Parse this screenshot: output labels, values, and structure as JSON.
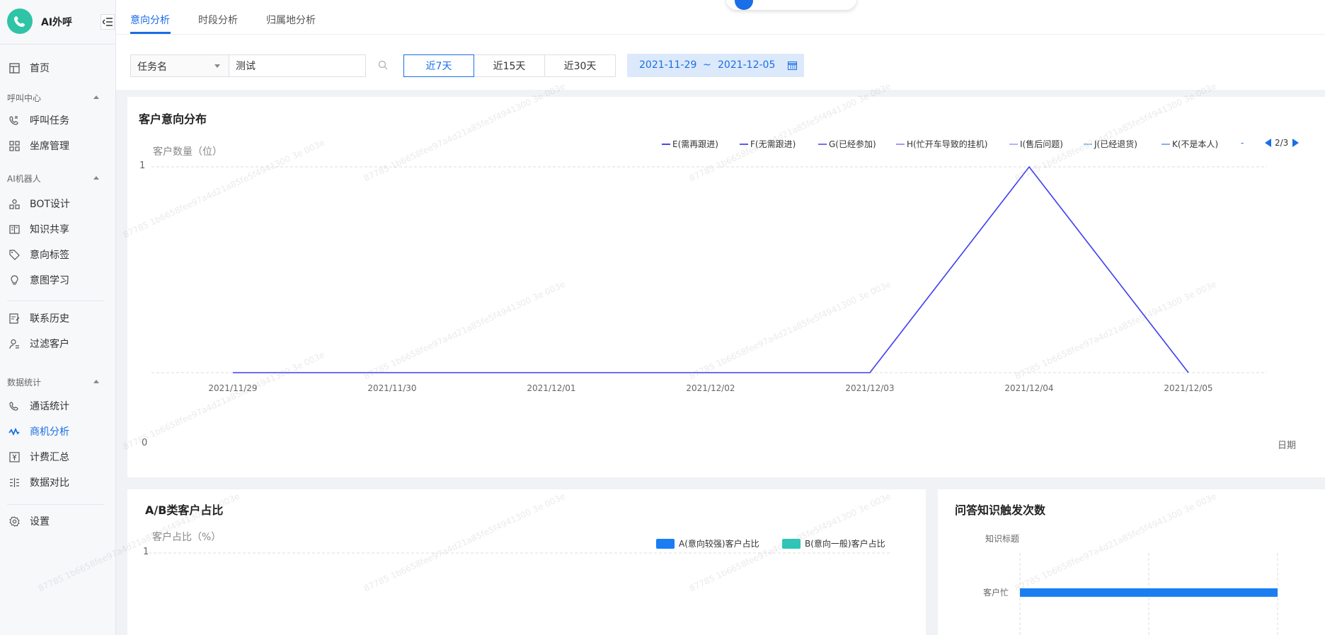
{
  "app": {
    "name": "AI外呼",
    "accent": "#1a6ee6",
    "logo_color": "#2ec4a5"
  },
  "sidebar": {
    "items": [
      {
        "label": "首页",
        "icon": "home-icon"
      },
      {
        "group": "呼叫中心"
      },
      {
        "label": "呼叫任务",
        "icon": "phone-task-icon"
      },
      {
        "label": "坐席管理",
        "icon": "grid-icon"
      },
      {
        "group": "AI机器人"
      },
      {
        "label": "BOT设计",
        "icon": "bot-design-icon"
      },
      {
        "label": "知识共享",
        "icon": "book-icon"
      },
      {
        "label": "意向标签",
        "icon": "tag-icon"
      },
      {
        "label": "意图学习",
        "icon": "bulb-icon"
      },
      {
        "label": "联系历史",
        "icon": "history-icon"
      },
      {
        "label": "过滤客户",
        "icon": "user-filter-icon"
      },
      {
        "group": "数据统计"
      },
      {
        "label": "通话统计",
        "icon": "call-stats-icon"
      },
      {
        "label": "商机分析",
        "icon": "trend-icon",
        "active": true
      },
      {
        "label": "计费汇总",
        "icon": "billing-icon"
      },
      {
        "label": "数据对比",
        "icon": "compare-icon"
      },
      {
        "label": "设置",
        "icon": "gear-icon"
      }
    ]
  },
  "tabs": [
    {
      "label": "意向分析",
      "active": true
    },
    {
      "label": "时段分析"
    },
    {
      "label": "归属地分析"
    }
  ],
  "filters": {
    "field_select": "任务名",
    "search_value": "测试",
    "ranges": [
      {
        "label": "近7天",
        "active": true
      },
      {
        "label": "近15天"
      },
      {
        "label": "近30天"
      }
    ],
    "date_start": "2021-11-29",
    "date_sep": "~",
    "date_end": "2021-12-05"
  },
  "intent_card": {
    "title": "客户意向分布",
    "legend_page": "2/3",
    "legend_overflow": "-"
  },
  "ab_card": {
    "title": "A/B类客户占比"
  },
  "qa_card": {
    "title": "问答知识触发次数"
  },
  "chart_data": [
    {
      "type": "line",
      "title": "客户意向分布",
      "ylabel": "客户数量（位）",
      "xlabel": "日期",
      "x": [
        "2021/11/29",
        "2021/11/30",
        "2021/12/01",
        "2021/12/02",
        "2021/12/03",
        "2021/12/04",
        "2021/12/05"
      ],
      "ylim": [
        0,
        1
      ],
      "yticks": [
        "0",
        "1"
      ],
      "grid": true,
      "legend_placement": "top-right",
      "legend": [
        {
          "name": "E(需再跟进)",
          "color": "#4a4ae8"
        },
        {
          "name": "F(无需跟进)",
          "color": "#5a5aee"
        },
        {
          "name": "G(已经参加)",
          "color": "#7070f0"
        },
        {
          "name": "H(忙开车导致的挂机)",
          "color": "#9c9cf4"
        },
        {
          "name": "I(售后问题)",
          "color": "#b0b4f6"
        },
        {
          "name": "J(已经退货)",
          "color": "#9cc4f4"
        },
        {
          "name": "K(不是本人)",
          "color": "#7fb0ee"
        }
      ],
      "series": [
        {
          "color": "#3d3df0",
          "values": [
            0,
            0,
            0,
            0,
            0,
            1,
            0
          ]
        }
      ]
    },
    {
      "type": "bar",
      "title": "A/B类客户占比",
      "ylabel": "客户占比（%）",
      "yticks": [
        "1"
      ],
      "grid": true,
      "legend_placement": "top-right",
      "series": [
        {
          "name": "A(意向较强)客户占比",
          "color": "#1a7ef2"
        },
        {
          "name": "B(意向一般)客户占比",
          "color": "#2cc6b8"
        }
      ]
    },
    {
      "type": "bar",
      "title": "问答知识触发次数",
      "ylabel": "知识标题",
      "categories": [
        "客户忙"
      ],
      "series": [
        {
          "color": "#1a7ef2",
          "values": [
            1
          ]
        }
      ],
      "grid": true
    }
  ],
  "watermark_text": "87785 1b6658fee97a4d21a85fe5f4941300 3e 003e"
}
